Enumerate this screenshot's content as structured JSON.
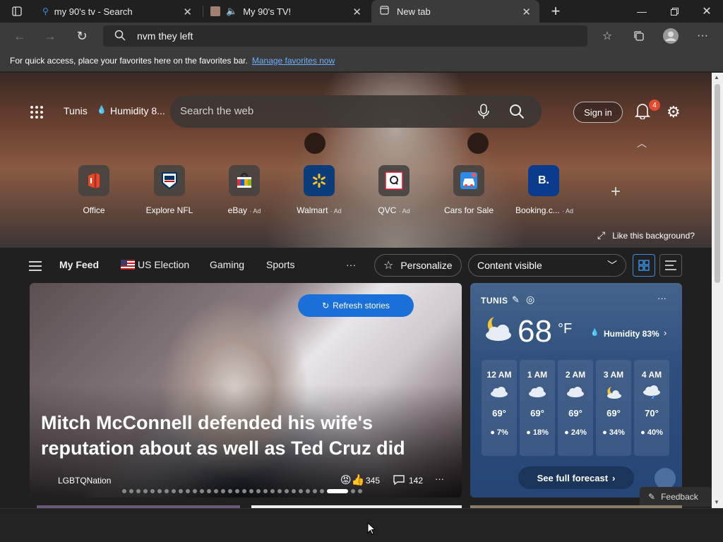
{
  "tabs": [
    {
      "title": "my 90's tv - Search",
      "icon": "search-icon"
    },
    {
      "title": "My 90's TV!",
      "icon": "speaker-icon"
    },
    {
      "title": "New tab",
      "icon": "newtab-icon"
    }
  ],
  "address": {
    "query": "nvm they left"
  },
  "favorites_bar": {
    "message": "For quick access, place your favorites here on the favorites bar.",
    "link": "Manage favorites now"
  },
  "hero": {
    "location": "Tunis",
    "humidity": "Humidity 8...",
    "search_placeholder": "Search the web",
    "sign_in": "Sign in",
    "notification_count": "4",
    "like_background": "Like this background?",
    "quick_links": [
      {
        "label": "Office",
        "ad": ""
      },
      {
        "label": "Explore NFL",
        "ad": ""
      },
      {
        "label": "eBay",
        "ad": "· Ad"
      },
      {
        "label": "Walmart",
        "ad": "· Ad"
      },
      {
        "label": "QVC",
        "ad": "· Ad"
      },
      {
        "label": "Cars for Sale",
        "ad": ""
      },
      {
        "label": "Booking.c...",
        "ad": "· Ad"
      }
    ]
  },
  "feed_nav": {
    "my_feed": "My Feed",
    "items": [
      "US Election",
      "Gaming",
      "Sports"
    ],
    "more": "···",
    "personalize": "Personalize",
    "content_visible": "Content visible"
  },
  "story": {
    "refresh": "Refresh stories",
    "headline": "Mitch McConnell defended his wife's reputation about as well as Ted Cruz did",
    "source": "LGBTQNation",
    "reactions": "345",
    "comments": "142"
  },
  "weather": {
    "city": "TUNIS",
    "temp": "68",
    "unit": "°F",
    "humidity": "Humidity 83%",
    "hours": [
      {
        "time": "12 AM",
        "temp": "69°",
        "precip": "7%",
        "icon": "cloud-icon"
      },
      {
        "time": "1 AM",
        "temp": "69°",
        "precip": "18%",
        "icon": "cloud-icon"
      },
      {
        "time": "2 AM",
        "temp": "69°",
        "precip": "24%",
        "icon": "cloud-icon"
      },
      {
        "time": "3 AM",
        "temp": "69°",
        "precip": "34%",
        "icon": "partly-cloudy-icon"
      },
      {
        "time": "4 AM",
        "temp": "70°",
        "precip": "40%",
        "icon": "rain-cloud-icon"
      }
    ],
    "full_forecast": "See full forecast"
  },
  "feedback": "Feedback"
}
